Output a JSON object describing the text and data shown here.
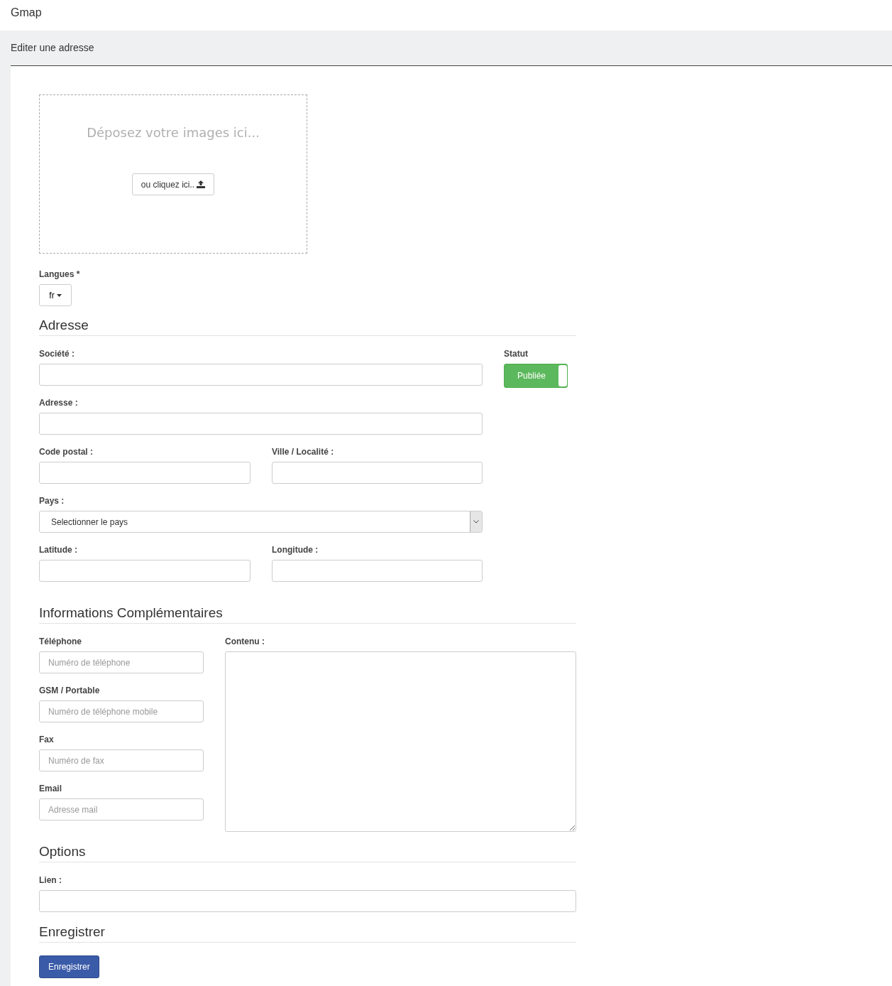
{
  "app": {
    "title": "Gmap"
  },
  "page": {
    "title": "Editer une adresse"
  },
  "dropzone": {
    "message": "Déposez votre images ici...",
    "button": "ou cliquez ici.."
  },
  "languages": {
    "label": "Langues *",
    "value": "fr"
  },
  "address_section": {
    "heading": "Adresse",
    "company": {
      "label": "Société :"
    },
    "address": {
      "label": "Adresse :"
    },
    "postal_code": {
      "label": "Code postal :"
    },
    "city": {
      "label": "Ville / Localité :"
    },
    "country": {
      "label": "Pays :",
      "value": "Selectionner le pays"
    },
    "latitude": {
      "label": "Latitude :"
    },
    "longitude": {
      "label": "Longitude :"
    },
    "status": {
      "label": "Statut",
      "toggle_label": "Publiée",
      "on": true
    }
  },
  "info_section": {
    "heading": "Informations Complémentaires",
    "contacts": [
      {
        "label": "Téléphone",
        "placeholder": "Numéro de téléphone"
      },
      {
        "label": "GSM / Portable",
        "placeholder": "Numéro de téléphone mobile"
      },
      {
        "label": "Fax",
        "placeholder": "Numéro de fax"
      },
      {
        "label": "Email",
        "placeholder": "Adresse mail"
      }
    ],
    "content": {
      "label": "Contenu :"
    }
  },
  "options_section": {
    "heading": "Options",
    "link": {
      "label": "Lien :"
    }
  },
  "save_section": {
    "heading": "Enregistrer",
    "button": "Enregistrer"
  }
}
